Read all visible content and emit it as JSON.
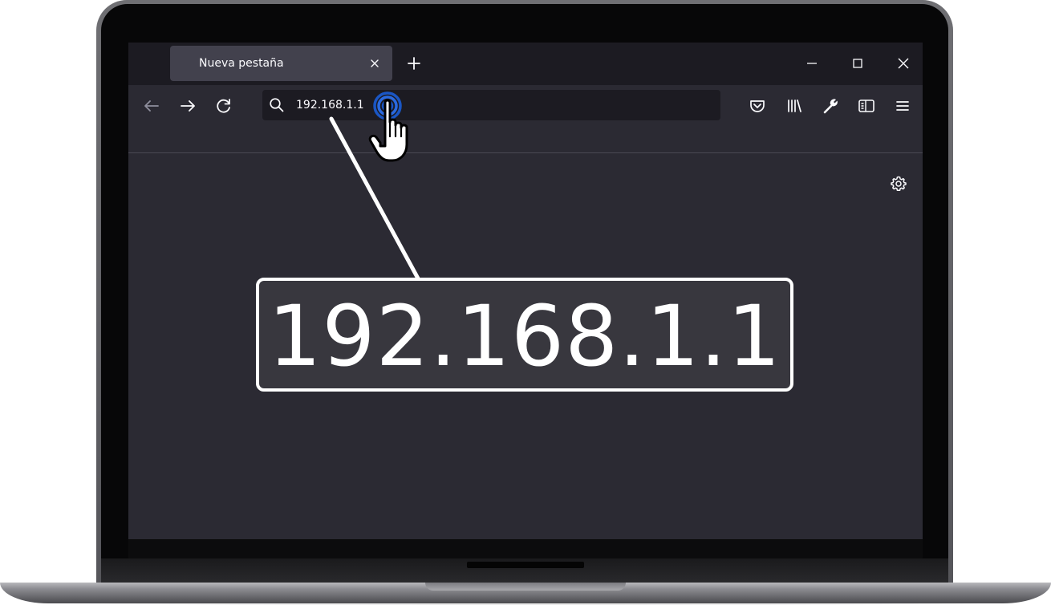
{
  "browser": {
    "tab": {
      "title": "Nueva pestaña"
    },
    "address_bar": {
      "value": "192.168.1.1"
    },
    "icons": {
      "tab_close": "close-icon",
      "new_tab": "plus-icon",
      "minimize": "minimize-icon",
      "maximize": "maximize-icon",
      "close_window": "close-icon",
      "back": "arrow-left-icon",
      "forward": "arrow-right-icon",
      "reload": "reload-icon",
      "search": "search-icon",
      "pocket": "pocket-icon",
      "library": "library-icon",
      "tools": "wrench-icon",
      "sidebar": "sidebar-icon",
      "menu": "hamburger-menu-icon",
      "settings": "gear-icon"
    }
  },
  "callout": {
    "text": "192.168.1.1"
  },
  "colors": {
    "tabbar_bg": "#1c1b22",
    "toolbar_bg": "#2b2a33",
    "active_tab_bg": "#42414d",
    "urlbar_bg": "#1c1b22",
    "callout_bg": "#38373e",
    "click_ring": "#1a56c4"
  }
}
